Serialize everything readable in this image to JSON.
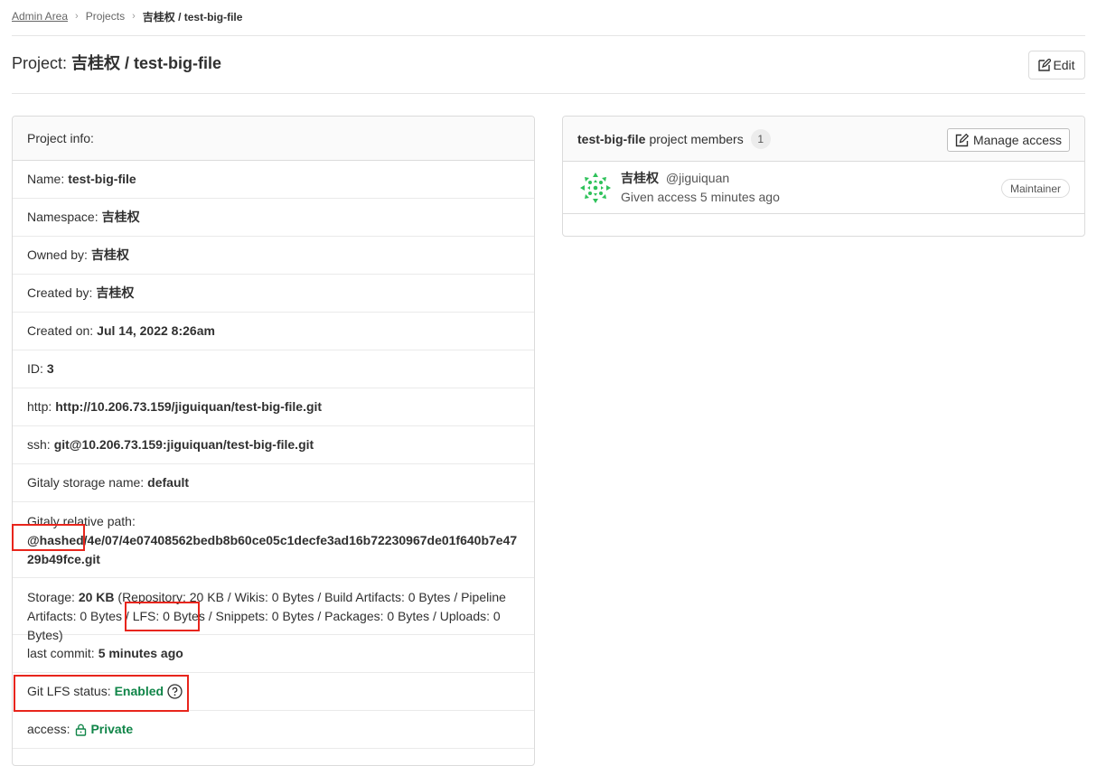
{
  "breadcrumb": {
    "items": [
      "Admin Area",
      "Projects"
    ],
    "current": "吉桂权 / test-big-file"
  },
  "header": {
    "title_prefix": "Project:",
    "title_name": "吉桂权 / test-big-file",
    "edit_label": "Edit"
  },
  "project_info": {
    "header": "Project info:",
    "name_label": "Name:",
    "name": "test-big-file",
    "namespace_label": "Namespace:",
    "namespace": "吉桂权",
    "owned_by_label": "Owned by:",
    "owned_by": "吉桂权",
    "created_by_label": "Created by:",
    "created_by": "吉桂权",
    "created_on_label": "Created on:",
    "created_on": "Jul 14, 2022 8:26am",
    "id_label": "ID:",
    "id": "3",
    "http_label": "http:",
    "http": "http://10.206.73.159/jiguiquan/test-big-file.git",
    "ssh_label": "ssh:",
    "ssh": "git@10.206.73.159:jiguiquan/test-big-file.git",
    "gitaly_storage_label": "Gitaly storage name:",
    "gitaly_storage": "default",
    "gitaly_path_label": "Gitaly relative path:",
    "gitaly_path": "@hashed/4e/07/4e07408562bedb8b60ce05c1decfe3ad16b72230967de01f640b7e4729b49fce.git",
    "storage_label": "Storage:",
    "storage_total": "20 KB",
    "storage_detail": "(Repository: 20 KB / Wikis: 0 Bytes / Build Artifacts: 0 Bytes / Pipeline Artifacts: 0 Bytes / LFS: 0 Bytes / Snippets: 0 Bytes / Packages: 0 Bytes / Uploads: 0 Bytes)",
    "last_commit_label": "last commit:",
    "last_commit": "5 minutes ago",
    "lfs_label": "Git LFS status:",
    "lfs_status": "Enabled",
    "access_label": "access:",
    "access": "Private"
  },
  "members": {
    "project_name": "test-big-file",
    "header_suffix": "project members",
    "count": "1",
    "manage_label": "Manage access",
    "list": [
      {
        "name": "吉桂权",
        "handle": "@jiguiquan",
        "sub": "Given access 5 minutes ago",
        "role": "Maintainer"
      }
    ]
  },
  "colors": {
    "accent_green": "#108548",
    "annotation_red": "#e8251c",
    "border": "#dbdbdb"
  }
}
